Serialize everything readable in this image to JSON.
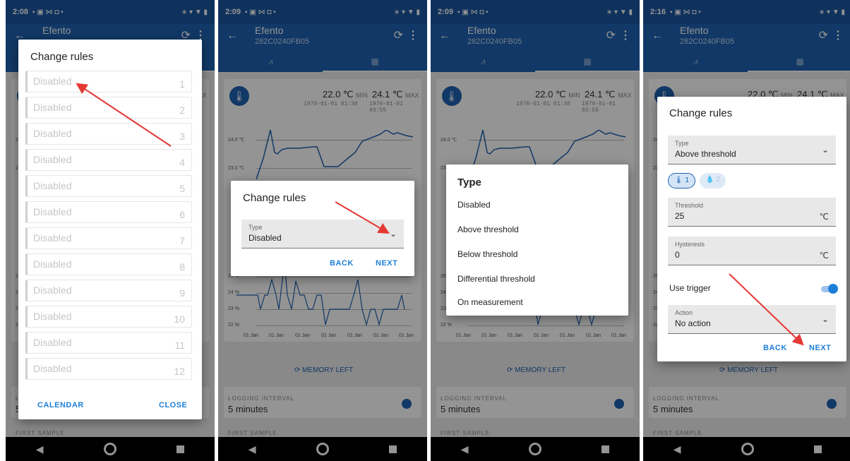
{
  "screens": [
    {
      "time": "2:08",
      "status_icons": "▪ ▣ ⋈ ◘ •",
      "status_right": "∗ ▾ ▼ ▮"
    },
    {
      "time": "2:09",
      "status_icons": "▪ ▣ ⋈ ◘ •",
      "status_right": "∗ ▾ ▼ ▮"
    },
    {
      "time": "2:09",
      "status_icons": "▪ ▣ ⋈ ◘ •",
      "status_right": "∗ ▾ ▼ ▮"
    },
    {
      "time": "2:16",
      "status_icons": "▪ ▣ ⋈ ◘ •",
      "status_right": "∗ ▾ ▼ ▮"
    }
  ],
  "app": {
    "title": "Efento",
    "serial": "282C0240FB05",
    "back_icon": "←",
    "sync_icon": "⟳",
    "menu_icon": "⋮",
    "tab_chart_icon": "⩘",
    "tab_list_icon": "▦"
  },
  "measurement": {
    "min_value": "22.0 ℃",
    "min_label": "MIN",
    "min_date": "1970-01-01 01:30",
    "max_value": "24.1 ℃",
    "max_label": "MAX",
    "max_date": "1970-01-01 03:55",
    "y_labels": [
      "24.0 ℃",
      "23.0 ℃"
    ],
    "hum_y_labels": [
      "25 %",
      "24 %",
      "23 %",
      "22 %"
    ],
    "x_labels": [
      "01 Jan",
      "01 Jan",
      "01 Jan",
      "01 Jan",
      "01 Jan",
      "01 Jan",
      "01 Jan"
    ],
    "memory_left": "MEMORY LEFT",
    "logging_interval_label": "LOGGING INTERVAL",
    "logging_interval_value": "5 minutes",
    "first_sample_label": "FIRST SAMPLE"
  },
  "rules_dialog": {
    "title": "Change rules",
    "rules": [
      {
        "label": "Disabled",
        "num": "1"
      },
      {
        "label": "Disabled",
        "num": "2"
      },
      {
        "label": "Disabled",
        "num": "3"
      },
      {
        "label": "Disabled",
        "num": "4"
      },
      {
        "label": "Disabled",
        "num": "5"
      },
      {
        "label": "Disabled",
        "num": "6"
      },
      {
        "label": "Disabled",
        "num": "7"
      },
      {
        "label": "Disabled",
        "num": "8"
      },
      {
        "label": "Disabled",
        "num": "9"
      },
      {
        "label": "Disabled",
        "num": "10"
      },
      {
        "label": "Disabled",
        "num": "11"
      },
      {
        "label": "Disabled",
        "num": "12"
      }
    ],
    "calendar": "CALENDAR",
    "close": "CLOSE"
  },
  "type_dialog": {
    "title": "Change rules",
    "type_label": "Type",
    "type_value": "Disabled",
    "back": "BACK",
    "next": "NEXT"
  },
  "type_menu": {
    "title": "Type",
    "options": [
      "Disabled",
      "Above threshold",
      "Below threshold",
      "Differential threshold",
      "On measurement"
    ]
  },
  "threshold_dialog": {
    "title": "Change rules",
    "type_label": "Type",
    "type_value": "Above threshold",
    "chip1": "1",
    "chip2": "2",
    "threshold_label": "Threshold",
    "threshold_value": "25",
    "threshold_unit": "℃",
    "hysteresis_label": "Hysteresis",
    "hysteresis_value": "0",
    "hysteresis_unit": "℃",
    "use_trigger": "Use trigger",
    "use_trigger_on": true,
    "action_label": "Action",
    "action_value": "No action",
    "back": "BACK",
    "next": "NEXT"
  },
  "nav": {
    "back": "◀"
  },
  "colors": {
    "primary": "#1e61b0",
    "accent": "#1e7fd8",
    "arrow": "#e53935"
  }
}
